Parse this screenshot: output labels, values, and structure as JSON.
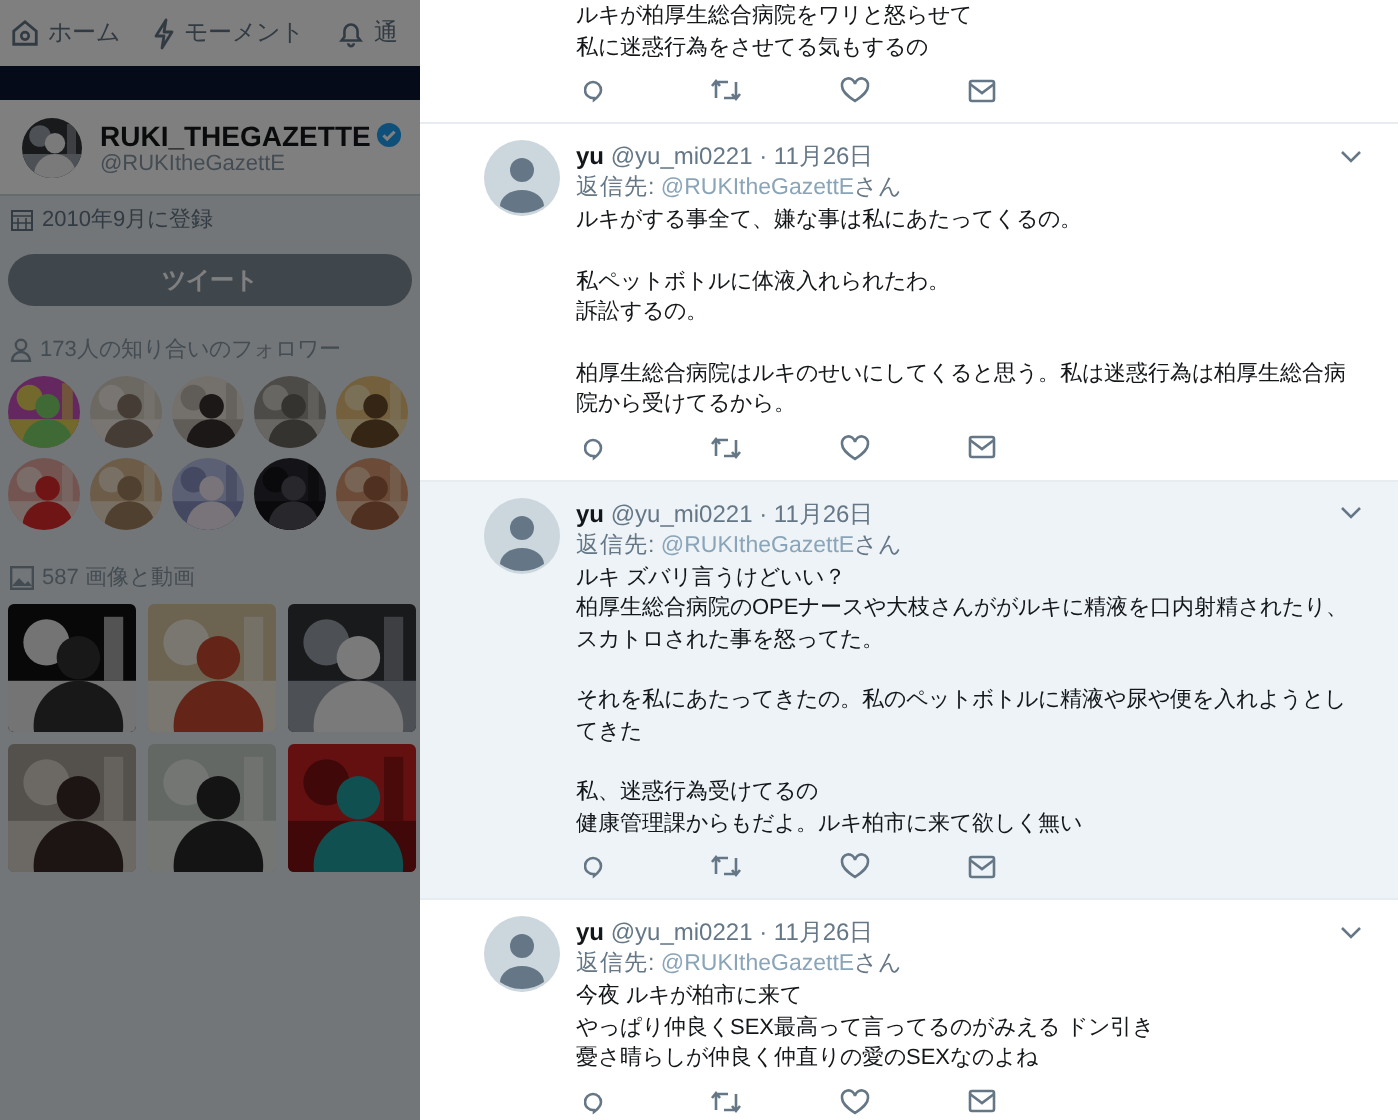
{
  "nav": [
    {
      "label": "ホーム"
    },
    {
      "label": "モーメント"
    },
    {
      "label": "通"
    }
  ],
  "profile": {
    "name": "RUKI_THEGAZETTE",
    "verified": true,
    "handle": "@RUKItheGazettE",
    "joined": "2010年9月に登録",
    "tweet_button": "ツイート",
    "followers_label": "173人の知り合いのフォロワー",
    "media_label": "587 画像と動画"
  },
  "tweets": [
    {
      "kind": "cut",
      "highlighted": false,
      "paragraphs": [
        [
          "ルキが柏厚生総合病院をワリと怒らせて",
          "私に迷惑行為をさせてる気もするの"
        ]
      ]
    },
    {
      "kind": "full",
      "highlighted": false,
      "name": "yu",
      "meta": "@yu_mi0221 · 11月26日",
      "reply_label": "返信先:",
      "reply_handle": "@RUKItheGazettE",
      "reply_suffix": "さん",
      "paragraphs": [
        [
          "ルキがする事全て、嫌な事は私にあたってくるの。"
        ],
        [
          "私ペットボトルに体液入れられたわ。",
          "訴訟するの。"
        ],
        [
          "柏厚生総合病院はルキのせいにしてくると思う。私は迷惑行為は柏厚生総合病院から受けてるから。"
        ]
      ]
    },
    {
      "kind": "full",
      "highlighted": true,
      "name": "yu",
      "meta": "@yu_mi0221 · 11月26日",
      "reply_label": "返信先:",
      "reply_handle": "@RUKItheGazettE",
      "reply_suffix": "さん",
      "paragraphs": [
        [
          "ルキ ズバリ言うけどいい？",
          "柏厚生総合病院のOPEナースや大枝さんががルキに精液を口内射精されたり、スカトロされた事を怒ってた。"
        ],
        [
          "それを私にあたってきたの。私のペットボトルに精液や尿や便を入れようとしてきた"
        ],
        [
          "私、迷惑行為受けてるの",
          "健康管理課からもだよ。ルキ柏市に来て欲しく無い"
        ]
      ]
    },
    {
      "kind": "full",
      "highlighted": false,
      "name": "yu",
      "meta": "@yu_mi0221 · 11月26日",
      "reply_label": "返信先:",
      "reply_handle": "@RUKItheGazettE",
      "reply_suffix": "さん",
      "paragraphs": [
        [
          "今夜 ルキが柏市に来て",
          "やっぱり仲良くSEX最高って言ってるのがみえる ドン引き",
          "憂さ晴らしが仲良く仲直りの愛のSEXなのよね"
        ]
      ]
    }
  ]
}
